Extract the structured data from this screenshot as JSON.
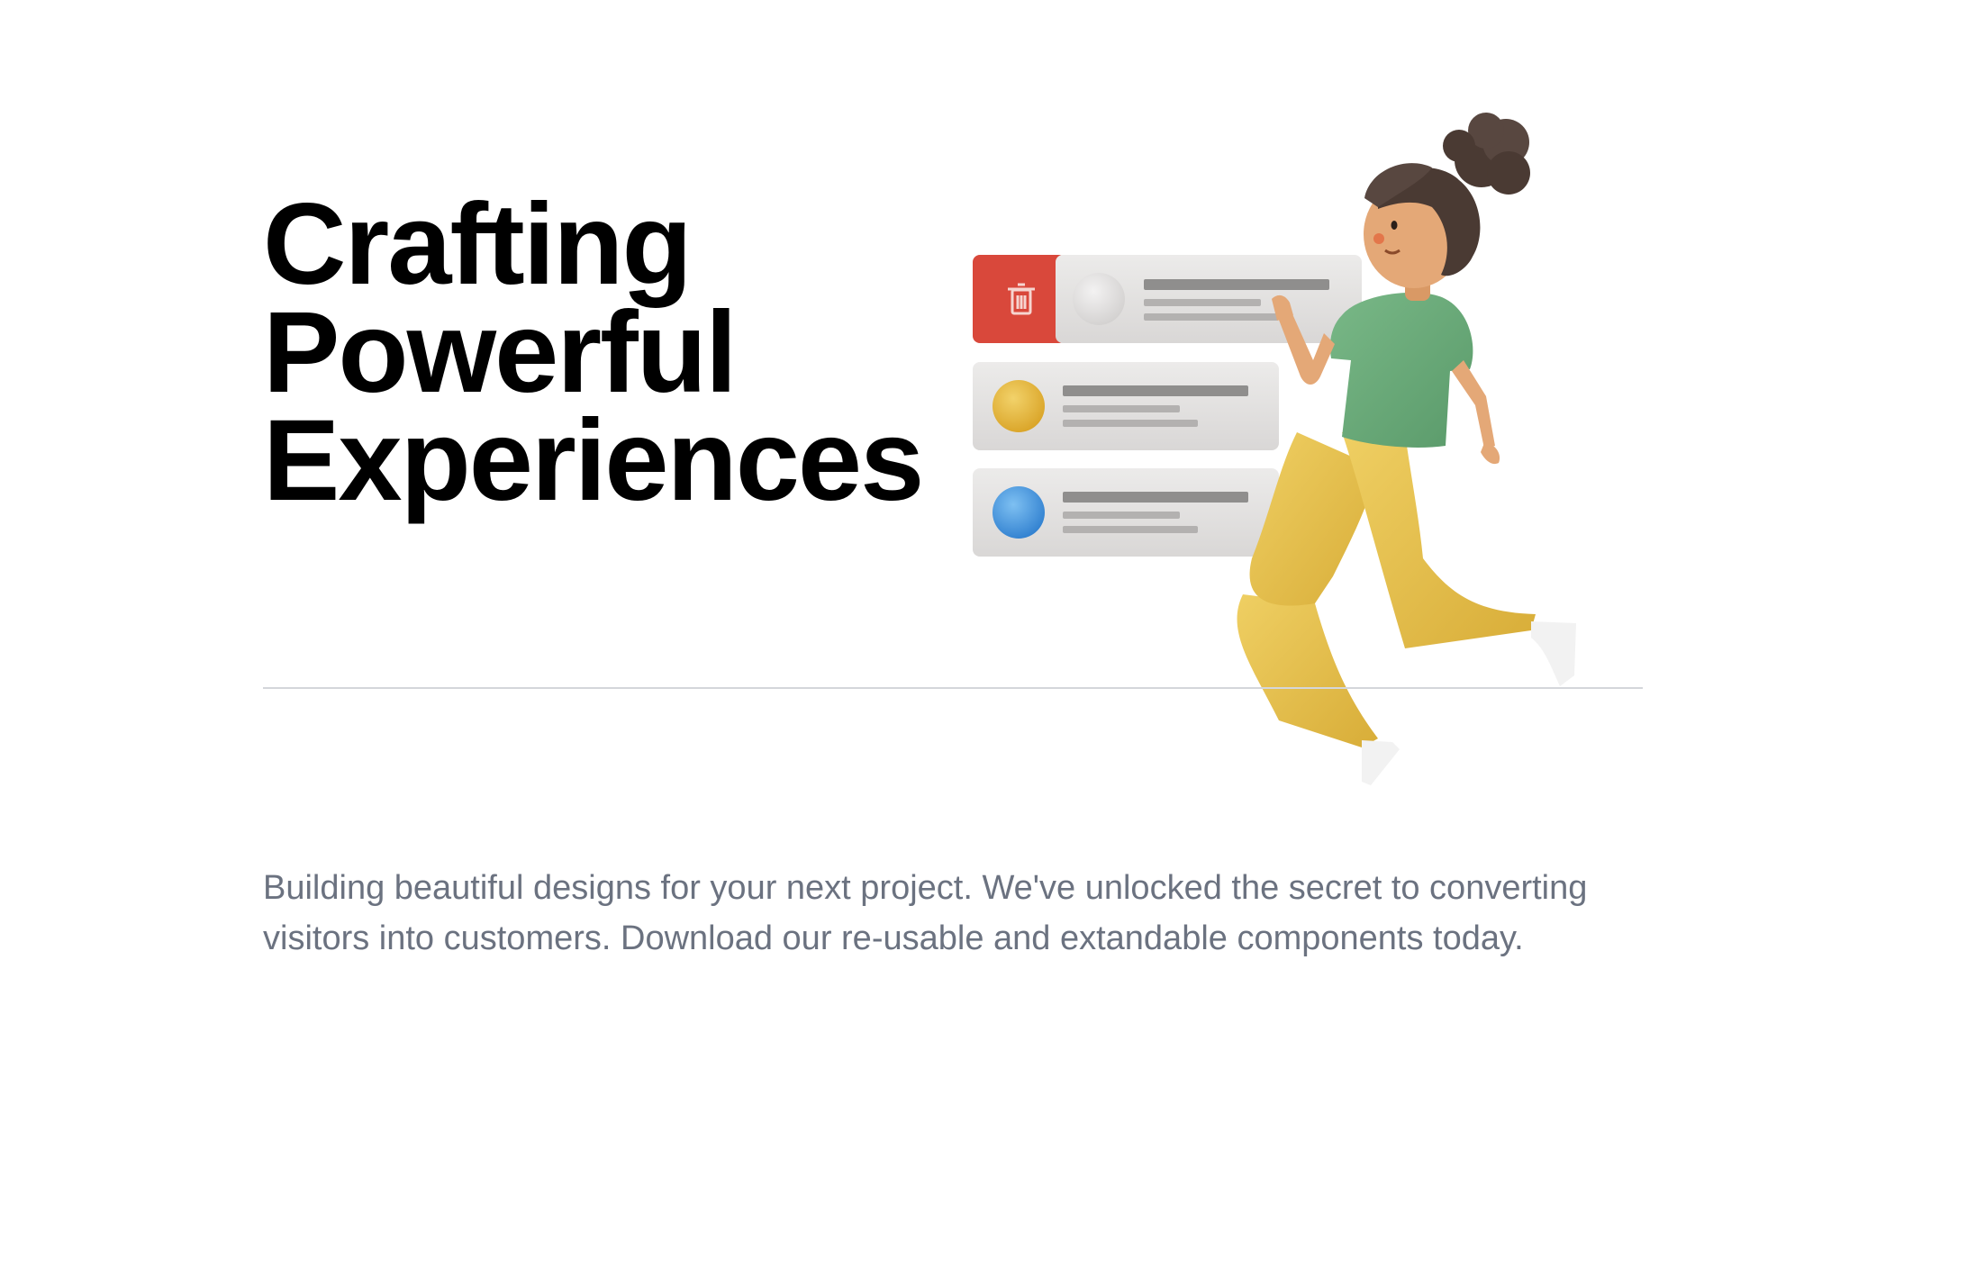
{
  "hero": {
    "title_lines": [
      "Crafting",
      "Powerful",
      "Experiences"
    ],
    "description": "Building beautiful designs for your next project. We've unlocked the secret to converting visitors into customers. Download our re-usable and extandable components today."
  },
  "illustration": {
    "icons": [
      "trash-icon"
    ],
    "colors": {
      "delete": "#d9483b",
      "card": "#e4e2e1",
      "yellow_dot": "#e5b531",
      "blue_dot": "#3f8fdc",
      "shirt": "#6aa97a",
      "pants": "#e6c250",
      "hair": "#4a3a33",
      "skin": "#e4a877"
    }
  }
}
